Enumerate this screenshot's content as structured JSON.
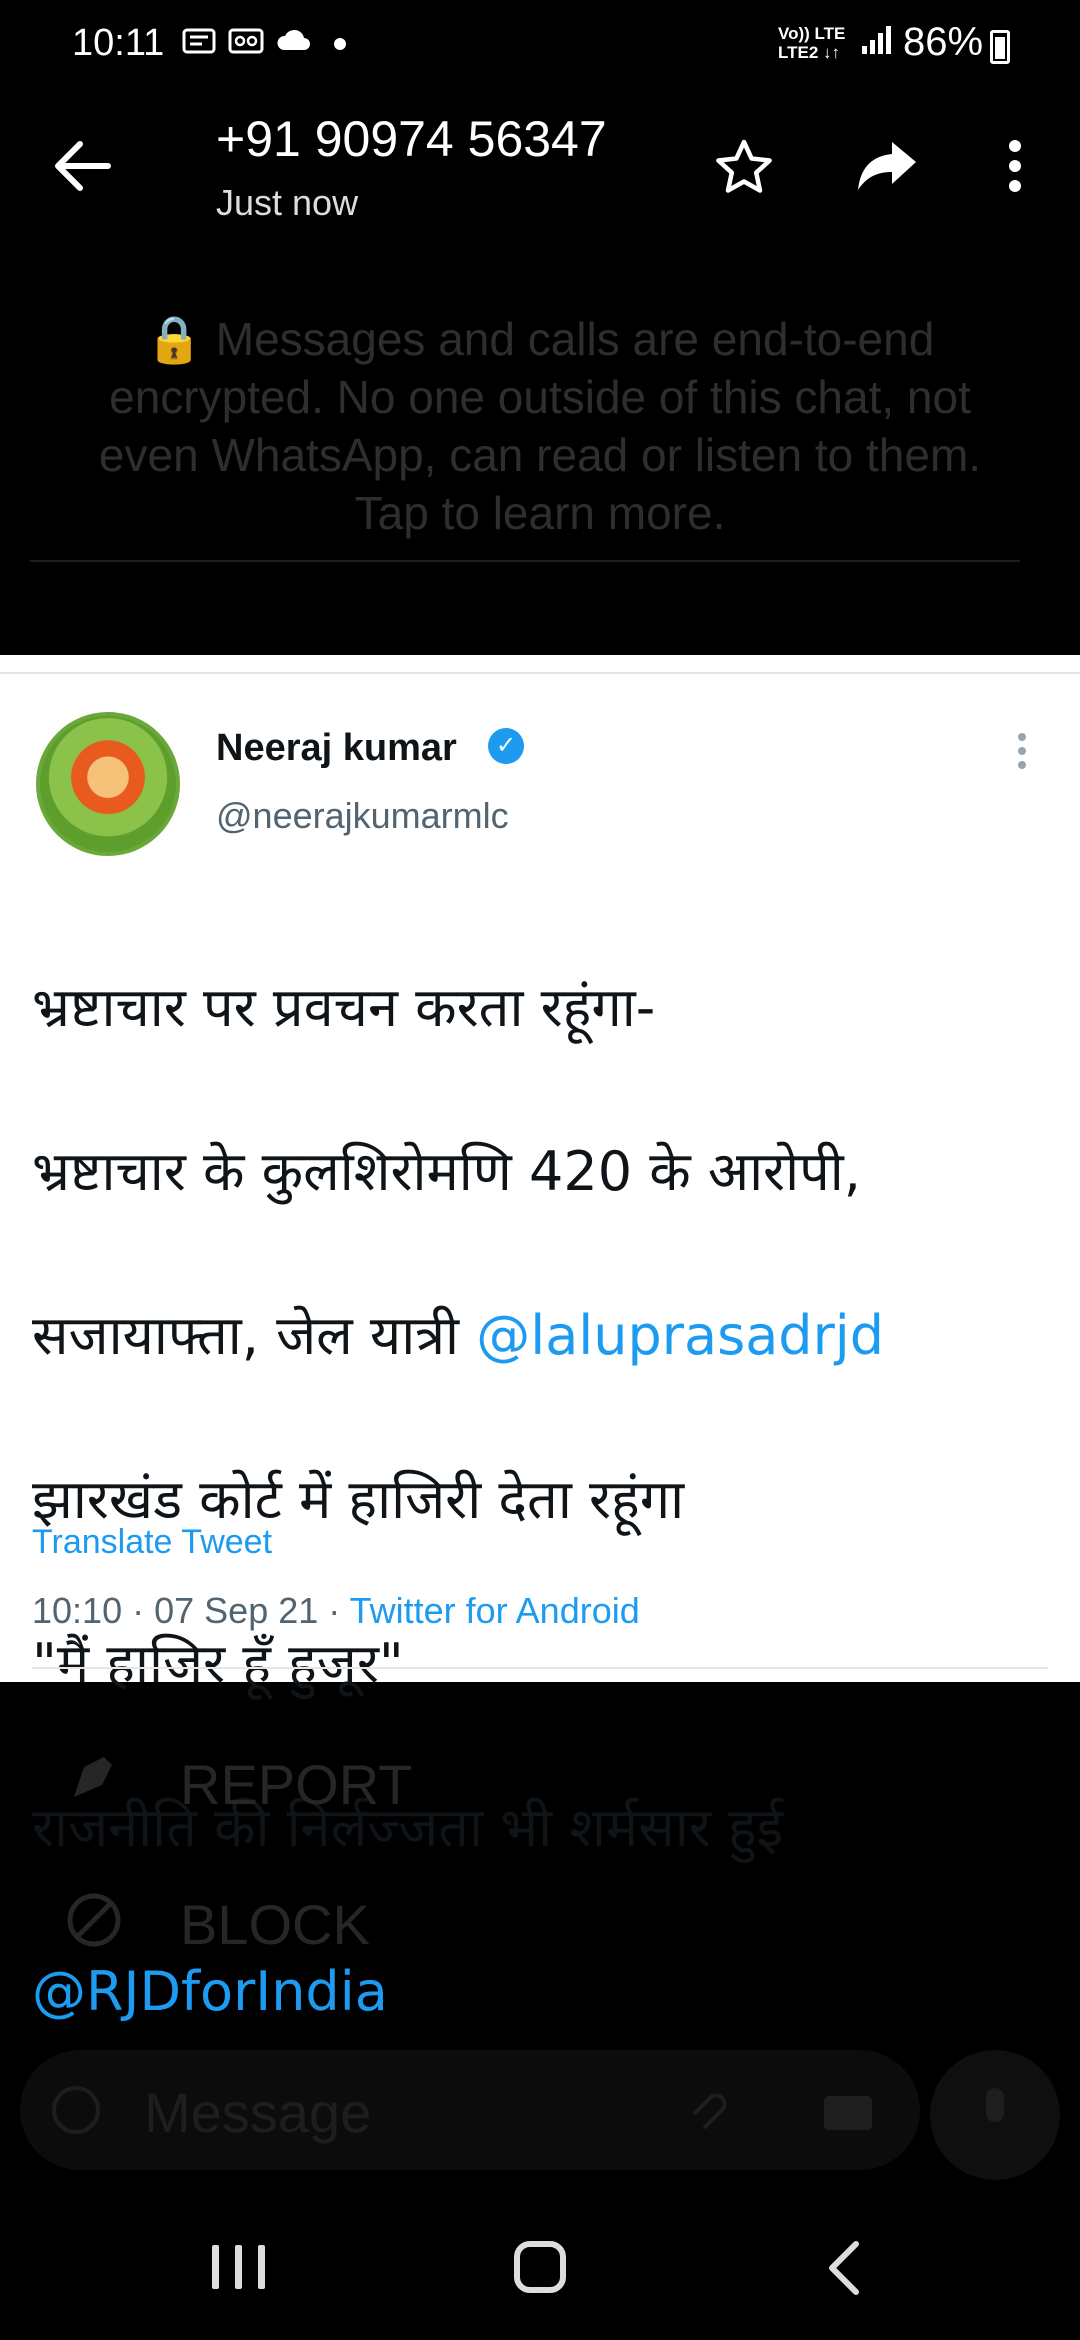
{
  "status_bar": {
    "time": "10:11",
    "network_top": "Vo)) LTE",
    "network_bottom": "LTE2 ↓↑",
    "battery": "86%"
  },
  "header": {
    "title": "+91 90974 56347",
    "subtitle": "Just now"
  },
  "tweet": {
    "author_name": "Neeraj kumar",
    "author_handle": "@neerajkumarmlc",
    "line1": "भ्रष्टाचार पर प्रवचन करता रहूंगा-",
    "line2": "भ्रष्टाचार के कुलशिरोमणि 420 के आरोपी,",
    "line3_text": "सजायाफ्ता, जेल यात्री ",
    "line3_mention": "@laluprasadrjd",
    "line4": " झारखंड कोर्ट में हाजिरी देता रहूंगा",
    "line5": "\"मैं हाजिर हूँ हुजूर\"",
    "line6": " राजनीति की निर्लज्जता भी शर्मसार हुई",
    "line7_mention": "@RJDforIndia",
    "translate_label": "Translate Tweet",
    "time": "10:10",
    "date": "07 Sep 21",
    "source": "Twitter for Android"
  },
  "background": {
    "encryption_notice": "🔒 Messages and calls are end-to-end encrypted. No one outside of this chat, not even WhatsApp, can read or listen to them. Tap to learn more.",
    "report_label": "REPORT",
    "block_label": "BLOCK",
    "message_placeholder": "Message"
  },
  "colors": {
    "accent_link": "#1d9bf0",
    "verified_badge": "#1d9bf0"
  }
}
